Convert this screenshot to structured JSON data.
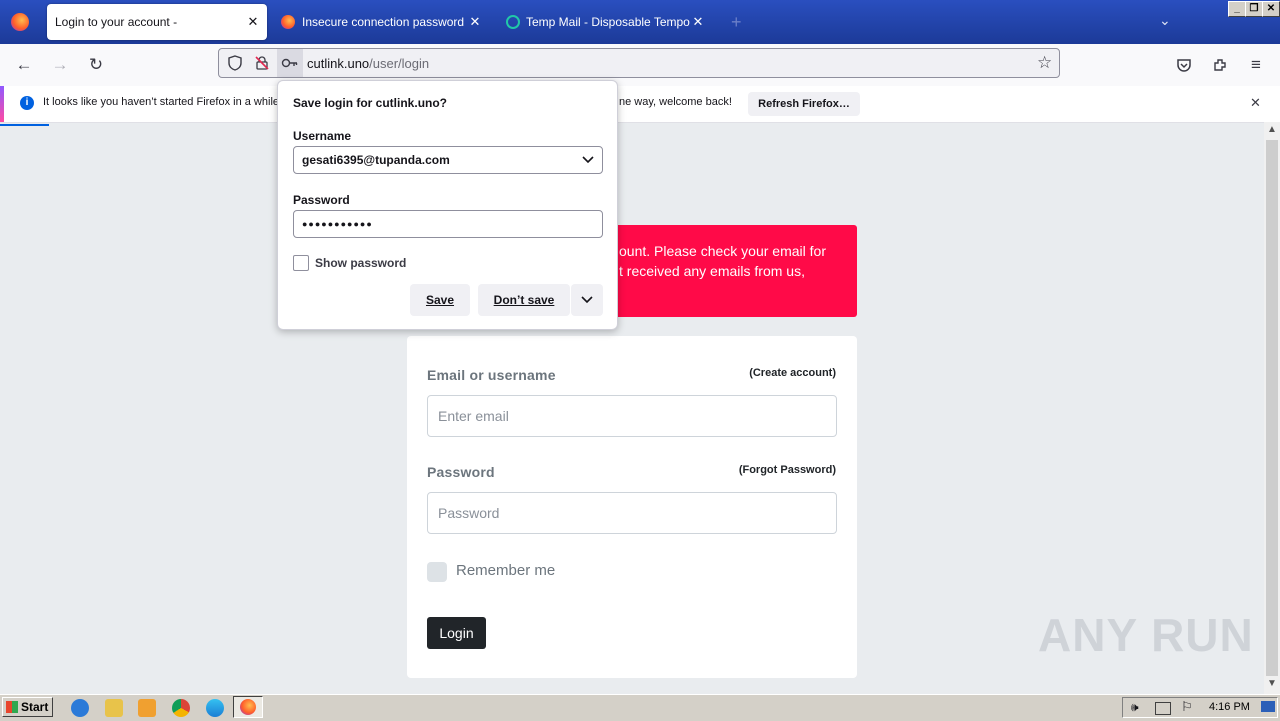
{
  "tabs": [
    {
      "title": "Login to your account -",
      "active": true
    },
    {
      "title": "Insecure connection password war",
      "active": false
    },
    {
      "title": "Temp Mail - Disposable Temporary E",
      "active": false
    }
  ],
  "tab_new_label": "+",
  "window_controls": {
    "minimize": "_",
    "restore": "❐",
    "close": "✕"
  },
  "urlbar": {
    "domain": "cutlink.uno",
    "path": "/user/login"
  },
  "notification": {
    "text_left": "It looks like you haven’t started Firefox in a while",
    "text_right": "ne way, welcome back!",
    "button": "Refresh Firefox…"
  },
  "popup": {
    "title": "Save login for cutlink.uno?",
    "username_label": "Username",
    "username_value": "gesati6395@tupanda.com",
    "password_label": "Password",
    "password_value": "●●●●●●●●●●●",
    "show_password": "Show password",
    "save": "Save",
    "dont_save": "Don’t save"
  },
  "alert": {
    "line1": "ount. Please check your email for",
    "line2": "t received any emails from us,"
  },
  "login": {
    "email_label": "Email or username",
    "create_account": "(Create account)",
    "email_placeholder": "Enter email",
    "password_label": "Password",
    "forgot_password": "(Forgot Password)",
    "password_placeholder": "Password",
    "remember_me": "Remember me",
    "login_button": "Login"
  },
  "watermark": "ANY RUN",
  "taskbar": {
    "start": "Start",
    "time": "4:16 PM"
  },
  "colors": {
    "alert_red": "#ff0a48",
    "login_button": "#212529",
    "firefox_blue": "#0061e0"
  }
}
